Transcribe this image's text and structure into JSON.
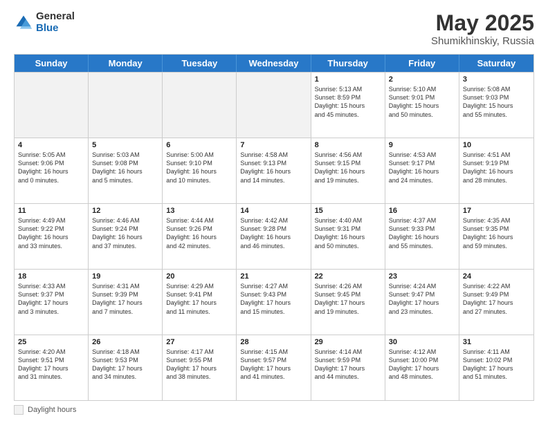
{
  "header": {
    "logo_line1": "General",
    "logo_line2": "Blue",
    "title_month": "May 2025",
    "title_location": "Shumikhinskiy, Russia"
  },
  "days_of_week": [
    "Sunday",
    "Monday",
    "Tuesday",
    "Wednesday",
    "Thursday",
    "Friday",
    "Saturday"
  ],
  "weeks": [
    [
      {
        "day": "",
        "info": "",
        "shaded": true
      },
      {
        "day": "",
        "info": "",
        "shaded": true
      },
      {
        "day": "",
        "info": "",
        "shaded": true
      },
      {
        "day": "",
        "info": "",
        "shaded": true
      },
      {
        "day": "1",
        "info": "Sunrise: 5:13 AM\nSunset: 8:59 PM\nDaylight: 15 hours\nand 45 minutes.",
        "shaded": false
      },
      {
        "day": "2",
        "info": "Sunrise: 5:10 AM\nSunset: 9:01 PM\nDaylight: 15 hours\nand 50 minutes.",
        "shaded": false
      },
      {
        "day": "3",
        "info": "Sunrise: 5:08 AM\nSunset: 9:03 PM\nDaylight: 15 hours\nand 55 minutes.",
        "shaded": false
      }
    ],
    [
      {
        "day": "4",
        "info": "Sunrise: 5:05 AM\nSunset: 9:06 PM\nDaylight: 16 hours\nand 0 minutes.",
        "shaded": false
      },
      {
        "day": "5",
        "info": "Sunrise: 5:03 AM\nSunset: 9:08 PM\nDaylight: 16 hours\nand 5 minutes.",
        "shaded": false
      },
      {
        "day": "6",
        "info": "Sunrise: 5:00 AM\nSunset: 9:10 PM\nDaylight: 16 hours\nand 10 minutes.",
        "shaded": false
      },
      {
        "day": "7",
        "info": "Sunrise: 4:58 AM\nSunset: 9:13 PM\nDaylight: 16 hours\nand 14 minutes.",
        "shaded": false
      },
      {
        "day": "8",
        "info": "Sunrise: 4:56 AM\nSunset: 9:15 PM\nDaylight: 16 hours\nand 19 minutes.",
        "shaded": false
      },
      {
        "day": "9",
        "info": "Sunrise: 4:53 AM\nSunset: 9:17 PM\nDaylight: 16 hours\nand 24 minutes.",
        "shaded": false
      },
      {
        "day": "10",
        "info": "Sunrise: 4:51 AM\nSunset: 9:19 PM\nDaylight: 16 hours\nand 28 minutes.",
        "shaded": false
      }
    ],
    [
      {
        "day": "11",
        "info": "Sunrise: 4:49 AM\nSunset: 9:22 PM\nDaylight: 16 hours\nand 33 minutes.",
        "shaded": false
      },
      {
        "day": "12",
        "info": "Sunrise: 4:46 AM\nSunset: 9:24 PM\nDaylight: 16 hours\nand 37 minutes.",
        "shaded": false
      },
      {
        "day": "13",
        "info": "Sunrise: 4:44 AM\nSunset: 9:26 PM\nDaylight: 16 hours\nand 42 minutes.",
        "shaded": false
      },
      {
        "day": "14",
        "info": "Sunrise: 4:42 AM\nSunset: 9:28 PM\nDaylight: 16 hours\nand 46 minutes.",
        "shaded": false
      },
      {
        "day": "15",
        "info": "Sunrise: 4:40 AM\nSunset: 9:31 PM\nDaylight: 16 hours\nand 50 minutes.",
        "shaded": false
      },
      {
        "day": "16",
        "info": "Sunrise: 4:37 AM\nSunset: 9:33 PM\nDaylight: 16 hours\nand 55 minutes.",
        "shaded": false
      },
      {
        "day": "17",
        "info": "Sunrise: 4:35 AM\nSunset: 9:35 PM\nDaylight: 16 hours\nand 59 minutes.",
        "shaded": false
      }
    ],
    [
      {
        "day": "18",
        "info": "Sunrise: 4:33 AM\nSunset: 9:37 PM\nDaylight: 17 hours\nand 3 minutes.",
        "shaded": false
      },
      {
        "day": "19",
        "info": "Sunrise: 4:31 AM\nSunset: 9:39 PM\nDaylight: 17 hours\nand 7 minutes.",
        "shaded": false
      },
      {
        "day": "20",
        "info": "Sunrise: 4:29 AM\nSunset: 9:41 PM\nDaylight: 17 hours\nand 11 minutes.",
        "shaded": false
      },
      {
        "day": "21",
        "info": "Sunrise: 4:27 AM\nSunset: 9:43 PM\nDaylight: 17 hours\nand 15 minutes.",
        "shaded": false
      },
      {
        "day": "22",
        "info": "Sunrise: 4:26 AM\nSunset: 9:45 PM\nDaylight: 17 hours\nand 19 minutes.",
        "shaded": false
      },
      {
        "day": "23",
        "info": "Sunrise: 4:24 AM\nSunset: 9:47 PM\nDaylight: 17 hours\nand 23 minutes.",
        "shaded": false
      },
      {
        "day": "24",
        "info": "Sunrise: 4:22 AM\nSunset: 9:49 PM\nDaylight: 17 hours\nand 27 minutes.",
        "shaded": false
      }
    ],
    [
      {
        "day": "25",
        "info": "Sunrise: 4:20 AM\nSunset: 9:51 PM\nDaylight: 17 hours\nand 31 minutes.",
        "shaded": false
      },
      {
        "day": "26",
        "info": "Sunrise: 4:18 AM\nSunset: 9:53 PM\nDaylight: 17 hours\nand 34 minutes.",
        "shaded": false
      },
      {
        "day": "27",
        "info": "Sunrise: 4:17 AM\nSunset: 9:55 PM\nDaylight: 17 hours\nand 38 minutes.",
        "shaded": false
      },
      {
        "day": "28",
        "info": "Sunrise: 4:15 AM\nSunset: 9:57 PM\nDaylight: 17 hours\nand 41 minutes.",
        "shaded": false
      },
      {
        "day": "29",
        "info": "Sunrise: 4:14 AM\nSunset: 9:59 PM\nDaylight: 17 hours\nand 44 minutes.",
        "shaded": false
      },
      {
        "day": "30",
        "info": "Sunrise: 4:12 AM\nSunset: 10:00 PM\nDaylight: 17 hours\nand 48 minutes.",
        "shaded": false
      },
      {
        "day": "31",
        "info": "Sunrise: 4:11 AM\nSunset: 10:02 PM\nDaylight: 17 hours\nand 51 minutes.",
        "shaded": false
      }
    ]
  ],
  "footer": {
    "daylight_label": "Daylight hours"
  }
}
